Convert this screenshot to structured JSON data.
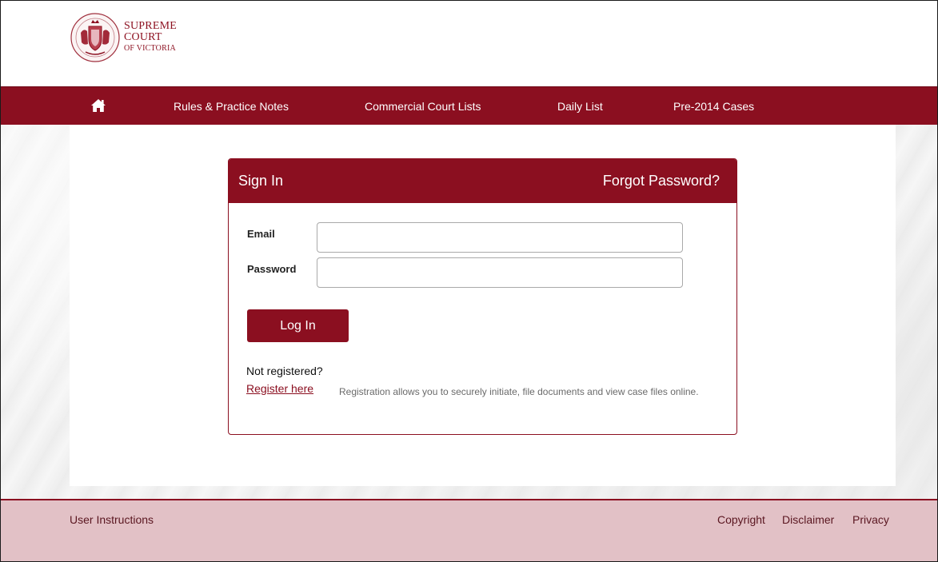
{
  "header": {
    "logo_line1": "SUPREME",
    "logo_line2": "COURT",
    "logo_line3": "OF VICTORIA"
  },
  "nav": {
    "home_icon": "home-icon",
    "items": [
      {
        "label": "Rules & Practice Notes"
      },
      {
        "label": "Commercial Court Lists"
      },
      {
        "label": "Daily List"
      },
      {
        "label": "Pre-2014 Cases"
      }
    ]
  },
  "signin": {
    "title": "Sign In",
    "forgot_label": "Forgot Password?",
    "email_label": "Email",
    "email_value": "",
    "password_label": "Password",
    "password_value": "",
    "login_label": "Log In",
    "not_registered": "Not registered?",
    "register_link": "Register here",
    "register_note": "Registration allows you to securely initiate, file documents and view case files online."
  },
  "footer": {
    "user_instructions": "User Instructions",
    "copyright": "Copyright",
    "disclaimer": "Disclaimer",
    "privacy": "Privacy"
  },
  "colors": {
    "brand": "#8b0f20",
    "footer_bg": "#e2c1c6"
  }
}
